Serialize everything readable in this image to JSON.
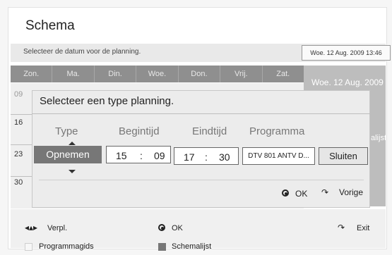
{
  "header": {
    "title": "Schema"
  },
  "subbar": {
    "prompt": "Selecteer de datum voor de planning.",
    "current_date": "Woe. 12 Aug. 2009 13:46"
  },
  "days": [
    "Zon.",
    "Ma.",
    "Din.",
    "Woe.",
    "Don.",
    "Vrij.",
    "Zat."
  ],
  "right_panel": {
    "date": "Woe. 12 Aug. 2009",
    "partial_label": "alijst"
  },
  "rows": [
    "09",
    "16",
    "23",
    "30"
  ],
  "dialog": {
    "title": "Selecteer een type planning.",
    "columns": {
      "type": "Type",
      "start": "Begintijd",
      "end": "Eindtijd",
      "program": "Programma"
    },
    "type_value": "Opnemen",
    "start_hour": "15",
    "start_min": "09",
    "end_hour": "17",
    "end_min": "30",
    "colon": ":",
    "program_value": "DTV 801 ANTV D...",
    "close_label": "Sluiten",
    "ok_label": "OK",
    "back_label": "Vorige"
  },
  "footer": {
    "move_label": "Verpl.",
    "ok_label": "OK",
    "exit_label": "Exit",
    "legend_programguide": "Programmagids",
    "legend_schedulelist": "Schemalijst"
  },
  "colors": {
    "accent_dark": "#777777",
    "day_strip": "#8f8f8f",
    "panel": "#bdbdbd"
  }
}
